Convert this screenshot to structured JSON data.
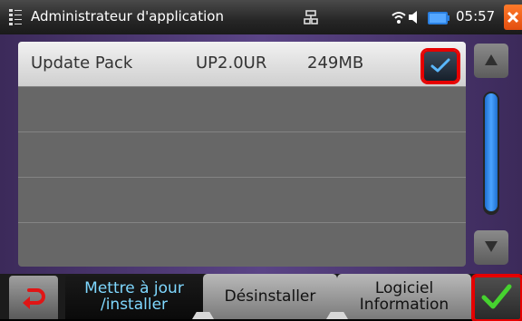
{
  "status_bar": {
    "app_icon": "app-manager-icon",
    "title": "Administrateur d'application",
    "network_icon": "network-icon",
    "wifi_icon": "wifi-icon",
    "sound_icon": "speaker-icon",
    "battery_icon": "battery-icon",
    "time": "05:57",
    "close_icon": "close-icon"
  },
  "list": {
    "rows": [
      {
        "name": "Update Pack",
        "version": "UP2.0UR",
        "size": "249MB",
        "checked": true
      }
    ],
    "empty_rows": 4
  },
  "scrollbar": {
    "up_icon": "triangle-up-icon",
    "down_icon": "triangle-down-icon"
  },
  "toolbar": {
    "back_icon": "back-arrow-icon",
    "tabs": [
      {
        "label_line1": "Mettre à jour",
        "label_line2": "/installer",
        "active": true
      },
      {
        "label_line1": "Désinstaller",
        "active": false
      },
      {
        "label_line1": "Logiciel",
        "label_line2": "Information",
        "active": false
      }
    ],
    "confirm_icon": "checkmark-icon"
  },
  "colors": {
    "panel": "#5a4486",
    "highlight_box": "#e60000",
    "active_tab_text": "#7fd8ff",
    "scroll_thumb": "#4aa3ff",
    "confirm_check": "#46d22f"
  }
}
